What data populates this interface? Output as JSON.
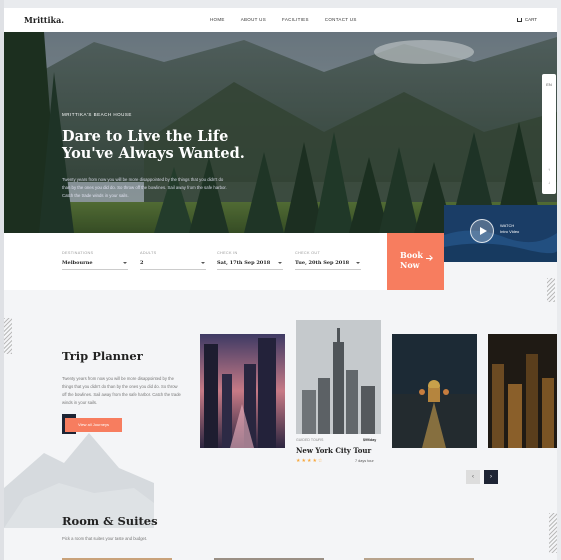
{
  "brand": {
    "logo": "Mrittika."
  },
  "nav": {
    "items": [
      "HOME",
      "ABOUT US",
      "FACILITIES",
      "CONTACT US"
    ],
    "cart_label": "CART"
  },
  "hero": {
    "kicker": "MRITTIKA'S BEACH HOUSE",
    "title": "Dare to Live the Life You've Always Wanted.",
    "description": "Twenty years from now you will be more disappointed by the things that you didn't do than by the ones you did do. So throw off the bowlines. Sail away from the safe harbor. Catch the trade winds in your sails.",
    "side_tools": [
      "EN",
      "↑",
      "↓"
    ],
    "video_label_line1": "WATCH",
    "video_label_line2": "Intro Video"
  },
  "booking": {
    "fields": [
      {
        "label": "DESTINATIONS",
        "value": "Melbourne"
      },
      {
        "label": "ADULTS",
        "value": "2"
      },
      {
        "label": "CHECK IN",
        "value": "Sat, 17th Sep 2018"
      },
      {
        "label": "CHECK OUT",
        "value": "Tue, 20th Sep 2018"
      }
    ],
    "button_line1": "Book",
    "button_line2": "Now"
  },
  "trip_planner": {
    "title": "Trip Planner",
    "description": "Twenty years from now you will be more disappointed by the things that you didn't do than by the ones you did do. So throw off the bowlines. Sail away from the safe harbor. Catch the trade winds in your sails.",
    "button": "View all Journeys",
    "featured_card": {
      "meta": "GUIDED TOURS",
      "price": "$99/day",
      "title": "New York City Tour",
      "rating_stars": "★★★★☆",
      "rating": 4,
      "duration": "7 days tour"
    },
    "pager": {
      "prev": "‹",
      "next": "›"
    }
  },
  "rooms": {
    "title": "Room & Suites",
    "description": "Pick a room that suites your taste and budget."
  },
  "colors": {
    "accent": "#f77d5f",
    "dark": "#1d2434",
    "stars": "#f7a940"
  }
}
